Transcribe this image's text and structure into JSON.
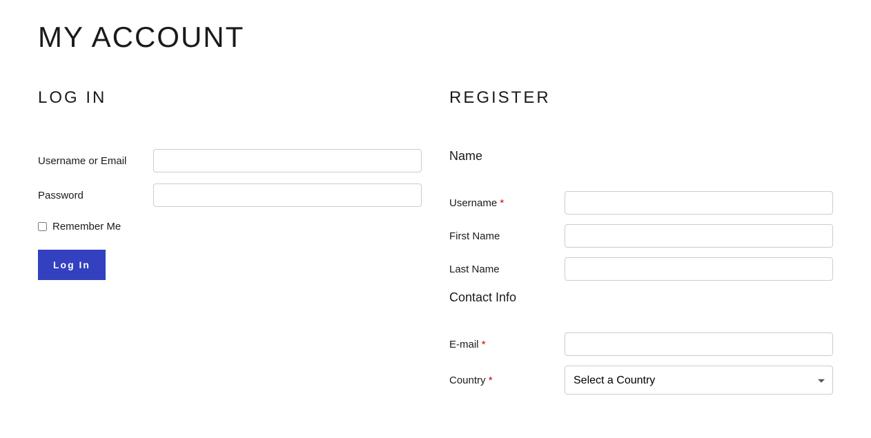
{
  "page": {
    "title": "MY ACCOUNT"
  },
  "login": {
    "heading": "LOG IN",
    "username_label": "Username or Email",
    "password_label": "Password",
    "remember_label": "Remember Me",
    "button_label": "Log In"
  },
  "register": {
    "heading": "REGISTER",
    "name_section": "Name",
    "contact_section": "Contact Info",
    "username_label": "Username",
    "first_name_label": "First Name",
    "last_name_label": "Last Name",
    "email_label": "E-mail",
    "country_label": "Country",
    "country_placeholder": "Select a Country",
    "required_marker": "*"
  }
}
